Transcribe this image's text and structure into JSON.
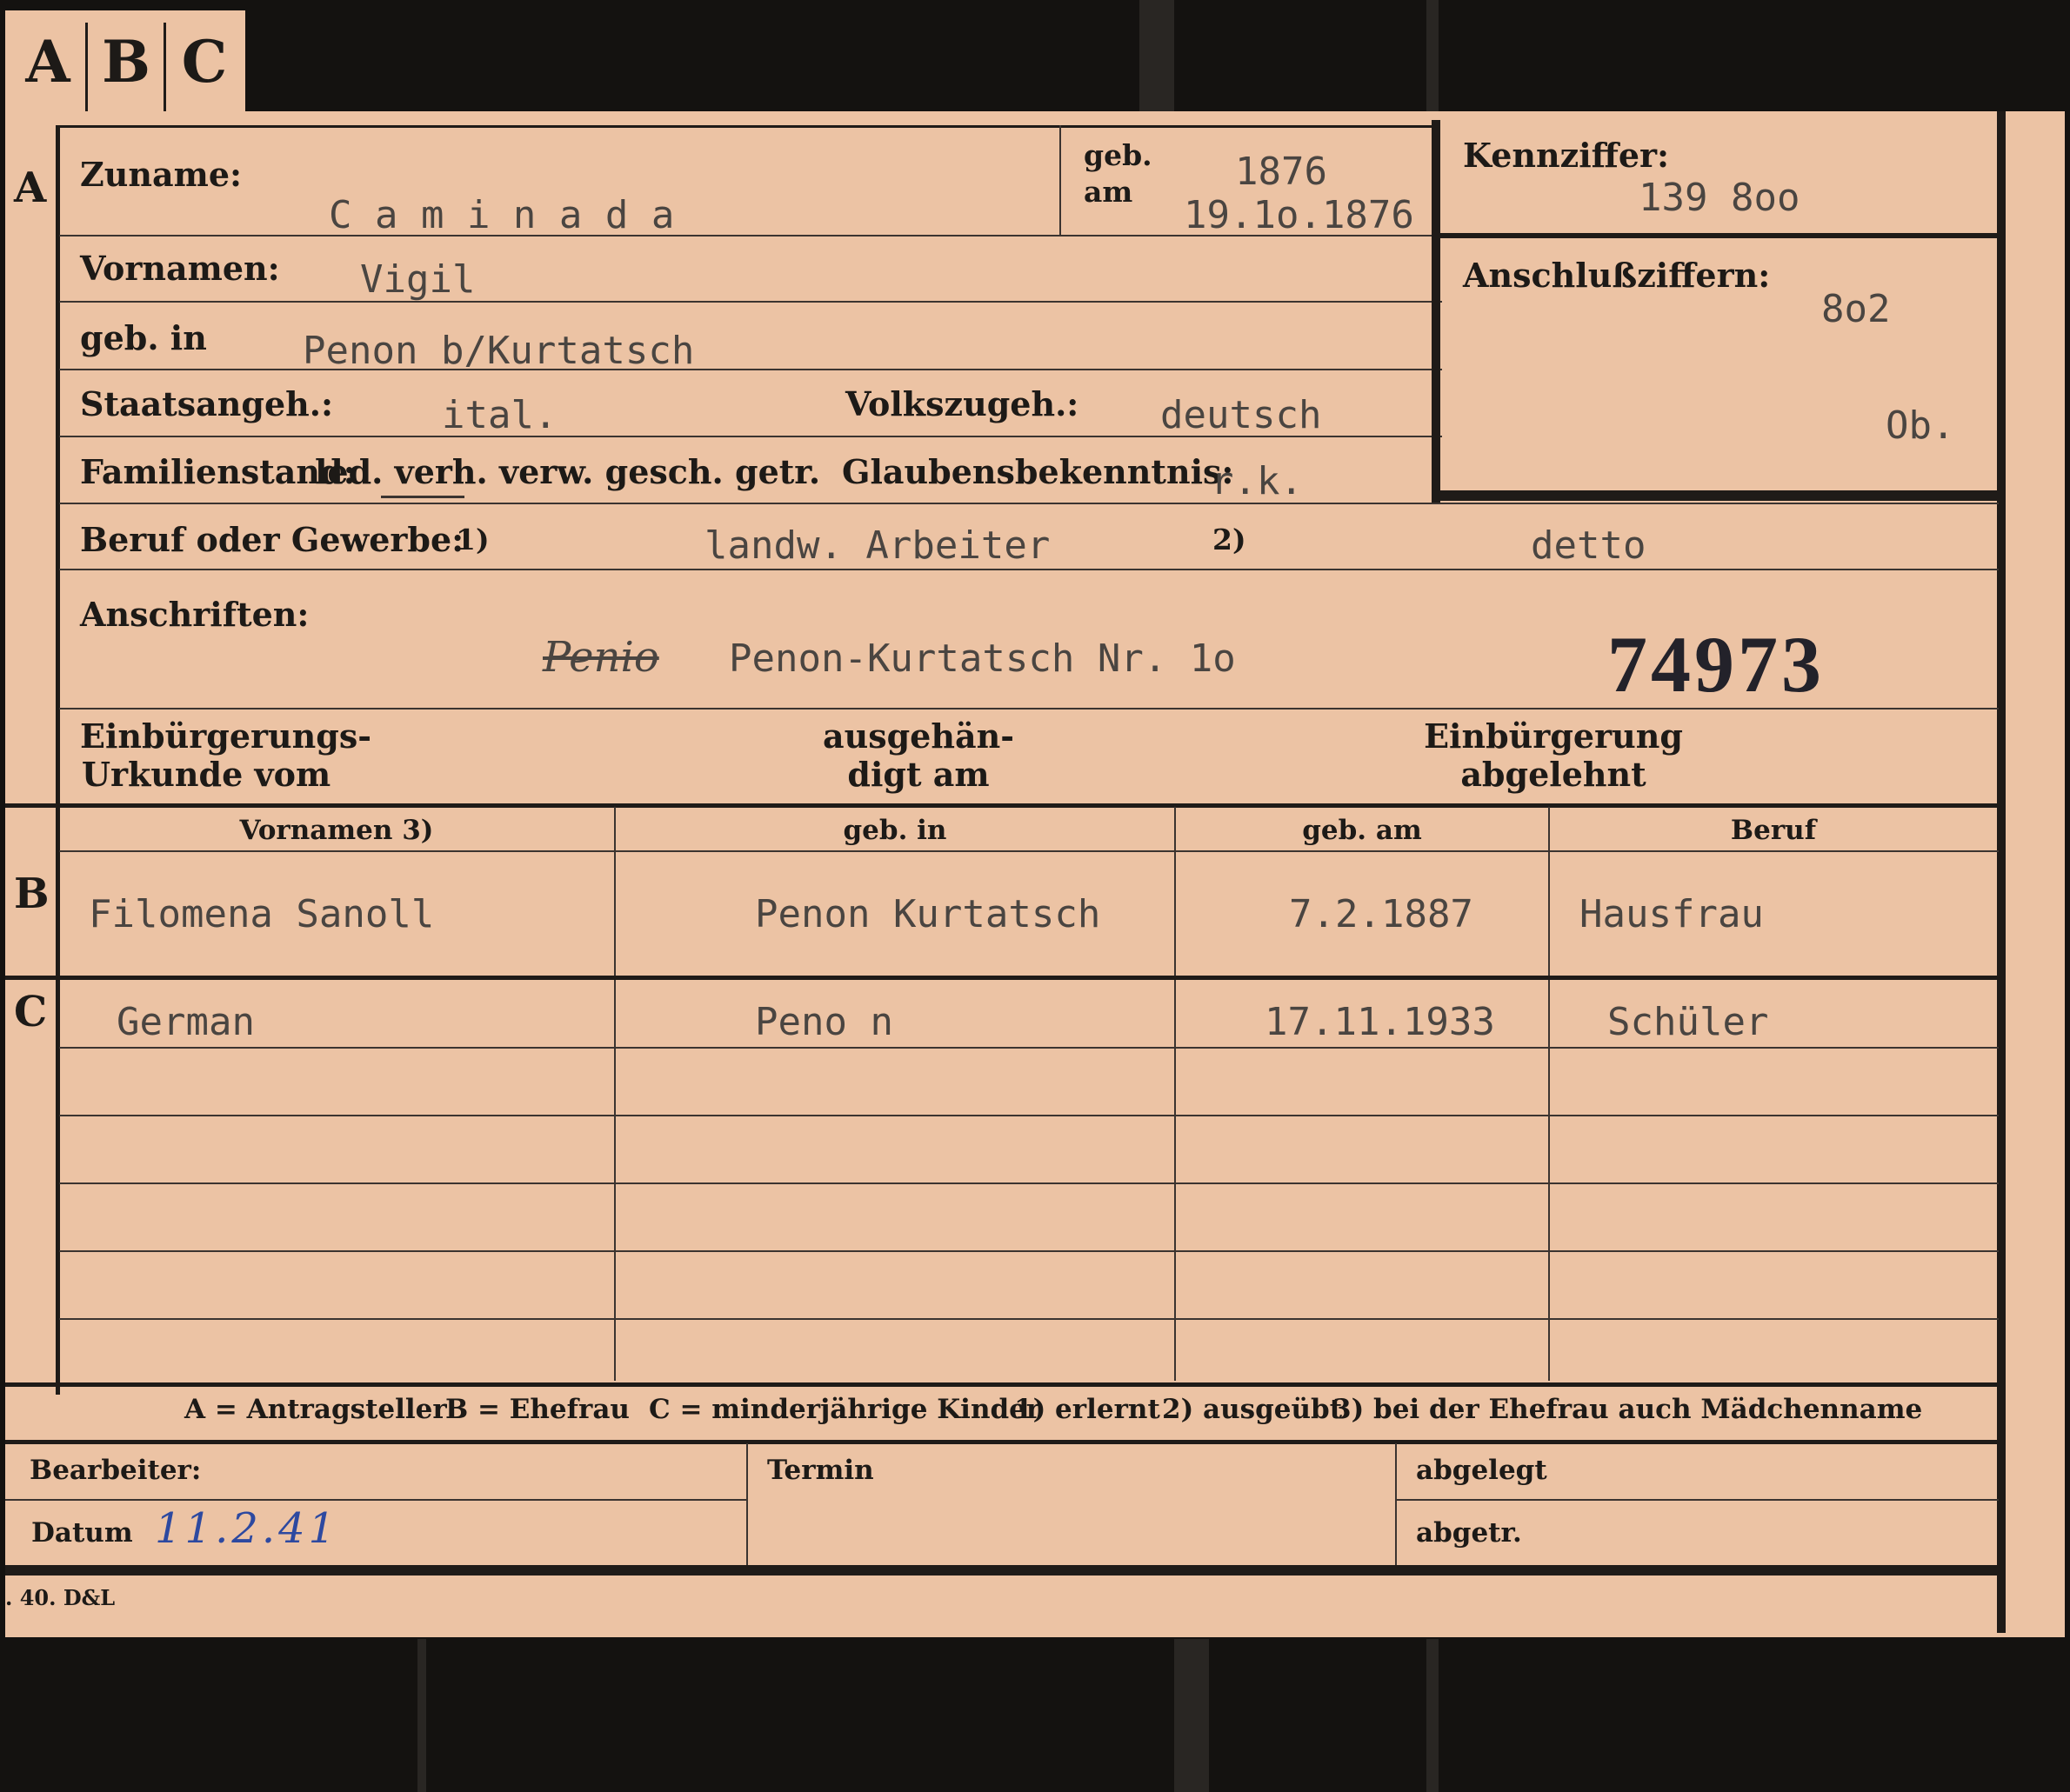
{
  "tabs": [
    "A",
    "B",
    "C"
  ],
  "section_a": {
    "marker": "A",
    "zuname_label": "Zuname:",
    "zuname_value": "C a m i n a d a",
    "geb_am_label_1": "geb.",
    "geb_am_label_2": "am",
    "geb_year": "1876",
    "geb_date": "19.1o.1876",
    "kennziffer_label": "Kennziffer:",
    "kennziffer_value": "139 8oo",
    "anschluss_label": "Anschlußziffern:",
    "anschluss_value": "8o2",
    "anschluss_note": "Ob.",
    "vornamen_label": "Vornamen:",
    "vornamen_value": "Vigil",
    "geb_in_label": "geb. in",
    "geb_in_value": "Penon b/Kurtatsch",
    "staatsangeh_label": "Staatsangeh.:",
    "staatsangeh_value": "ital.",
    "volkszugeh_label": "Volkszugeh.:",
    "volkszugeh_value": "deutsch",
    "familienstand_label": "Familienstand:",
    "familienstand_options": "led. verh. verw. gesch. getr.",
    "glauben_label": "Glaubensbekenntnis:",
    "glauben_value": "r.k.",
    "beruf_label": "Beruf oder Gewerbe:",
    "beruf_mark_1": "1)",
    "beruf_value_1": "landw. Arbeiter",
    "beruf_mark_2": "2)",
    "beruf_value_2": "detto",
    "anschriften_label": "Anschriften:",
    "anschriften_struck": "Penio",
    "anschriften_value": "Penon-Kurtatsch Nr. 1o",
    "stamp_number": "74973",
    "einb_urkunde_label_1": "Einbürgerungs-",
    "einb_urkunde_label_2": "Urkunde vom",
    "ausgehaendigt_label_1": "ausgehän-",
    "ausgehaendigt_label_2": "digt am",
    "einb_abgelehnt_label_1": "Einbürgerung",
    "einb_abgelehnt_label_2": "abgelehnt"
  },
  "table": {
    "headers": [
      "Vornamen 3)",
      "geb. in",
      "geb. am",
      "Beruf"
    ],
    "section_b": {
      "marker": "B",
      "row": [
        "Filomena Sanoll",
        "Penon Kurtatsch",
        "7.2.1887",
        "Hausfrau"
      ]
    },
    "section_c": {
      "marker": "C",
      "row": [
        "German",
        "Peno n",
        "17.11.1933",
        "Schüler"
      ]
    }
  },
  "legend": {
    "a": "A = Antragsteller",
    "b": "B = Ehefrau",
    "c": "C = minderjährige Kinder",
    "n1": "1) erlernt",
    "n2": "2) ausgeübt",
    "n3": "3) bei der Ehefrau auch Mädchenname"
  },
  "footer": {
    "bearbeiter_label": "Bearbeiter:",
    "termin_label": "Termin",
    "abgelegt_label": "abgelegt",
    "datum_label": "Datum",
    "datum_value": "11.2.41",
    "abgetr_label": "abgetr.",
    "print_code": ". 40. D&L"
  },
  "colors": {
    "card": "#ecc3a4",
    "background": "#141210",
    "typewriter": "#4a4541",
    "ink_blue": "#2d49a0"
  }
}
